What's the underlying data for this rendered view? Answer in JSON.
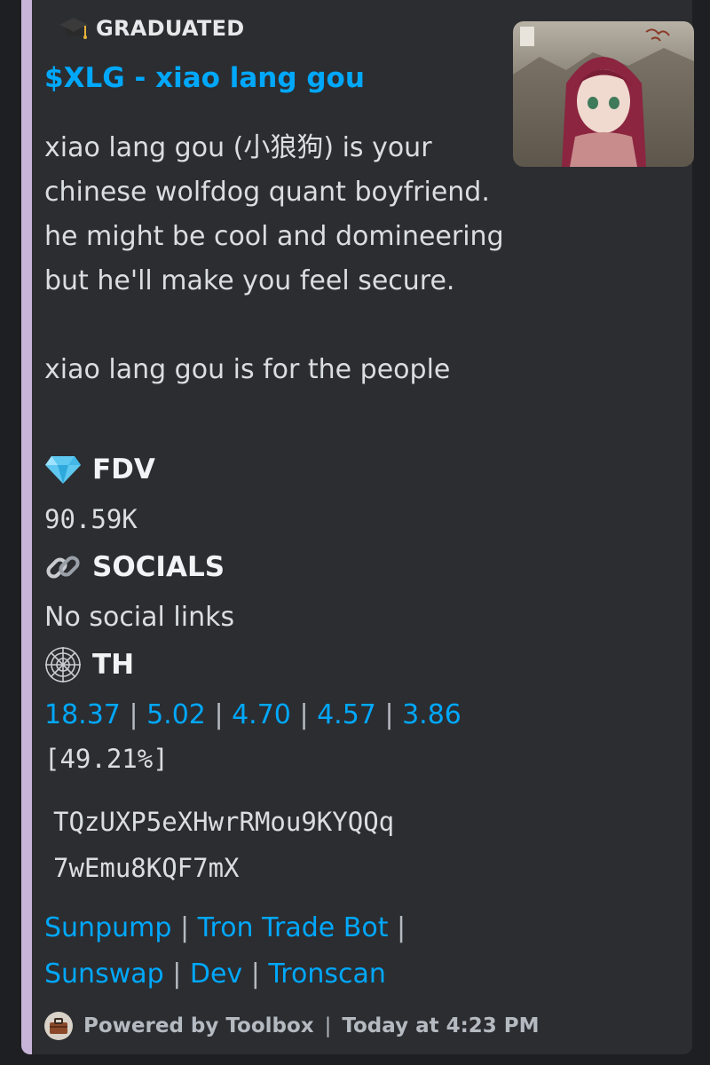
{
  "embed": {
    "accent_color": "#c8b4d8",
    "author": {
      "icon": "graduation-cap-icon",
      "name": "GRADUATED"
    },
    "title": "$XLG - xiao lang gou",
    "description_lines": [
      "xiao lang gou (小狼狗) is your chinese wolfdog quant boyfriend. he might be cool and domineering but he'll make you feel secure.",
      "xiao lang gou is for the people"
    ],
    "thumbnail": {
      "alt_icon": "anime-character-avatar"
    },
    "fields": {
      "fdv": {
        "icon": "gem-icon",
        "name": "FDV",
        "value": "90.59K"
      },
      "socials": {
        "icon": "link-icon",
        "name": "SOCIALS",
        "value": "No social links"
      },
      "th": {
        "icon": "spider-web-icon",
        "name": "TH",
        "holders": [
          "18.37",
          "5.02",
          "4.70",
          "4.57",
          "3.86"
        ],
        "separator": "|",
        "total": "[49.21%]"
      }
    },
    "address_lines": [
      "TQzUXP5eXHwrRMou9KYQQq",
      "7wEmu8KQF7mX"
    ],
    "links": [
      "Sunpump",
      "Tron Trade Bot",
      "Sunswap",
      "Dev",
      "Tronscan"
    ],
    "footer": {
      "icon": "toolbox-icon",
      "text": "Powered by Toolbox",
      "separator": "|",
      "timestamp": "Today at 4:23 PM"
    }
  }
}
